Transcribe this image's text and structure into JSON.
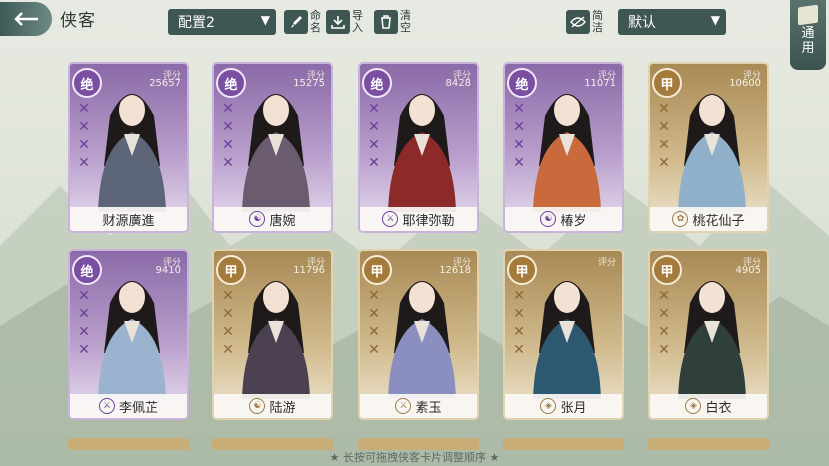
{
  "header": {
    "back_icon": "back-arrow-icon",
    "title": "侠客",
    "preset": "配置2",
    "rename_label": "命名",
    "import_label": "导入",
    "clear_label": "清空",
    "compact_label": "简洁",
    "sort": "默认",
    "general_label": "通用"
  },
  "score_label": "评分",
  "cards": [
    {
      "grade": "绝",
      "score": "25657",
      "name": "财源廣進",
      "sect": "",
      "tier": "jue"
    },
    {
      "grade": "绝",
      "score": "15275",
      "name": "唐婉",
      "sect": "yin-yang-icon",
      "tier": "jue"
    },
    {
      "grade": "绝",
      "score": "8428",
      "name": "耶律弥勒",
      "sect": "blade-icon",
      "tier": "jue"
    },
    {
      "grade": "绝",
      "score": "11071",
      "name": "椿岁",
      "sect": "yin-yang-icon",
      "tier": "jue"
    },
    {
      "grade": "甲",
      "score": "10600",
      "name": "桃花仙子",
      "sect": "flower-icon",
      "tier": "jia"
    },
    {
      "grade": "绝",
      "score": "9410",
      "name": "李佩芷",
      "sect": "blade-icon",
      "tier": "jue"
    },
    {
      "grade": "甲",
      "score": "11796",
      "name": "陆游",
      "sect": "yin-yang-icon",
      "tier": "jia"
    },
    {
      "grade": "甲",
      "score": "12618",
      "name": "素玉",
      "sect": "blade-icon",
      "tier": "jia"
    },
    {
      "grade": "甲",
      "score": "",
      "name": "张月",
      "sect": "shield-icon",
      "tier": "jia"
    },
    {
      "grade": "甲",
      "score": "4905",
      "name": "白衣",
      "sect": "shield-icon",
      "tier": "jia"
    }
  ],
  "hint": "★ 长按可拖拽侠客卡片调整顺序 ★",
  "colors": {
    "jue": "#8a6aa8",
    "jia": "#a88a55",
    "toolbar": "#3f5753"
  }
}
